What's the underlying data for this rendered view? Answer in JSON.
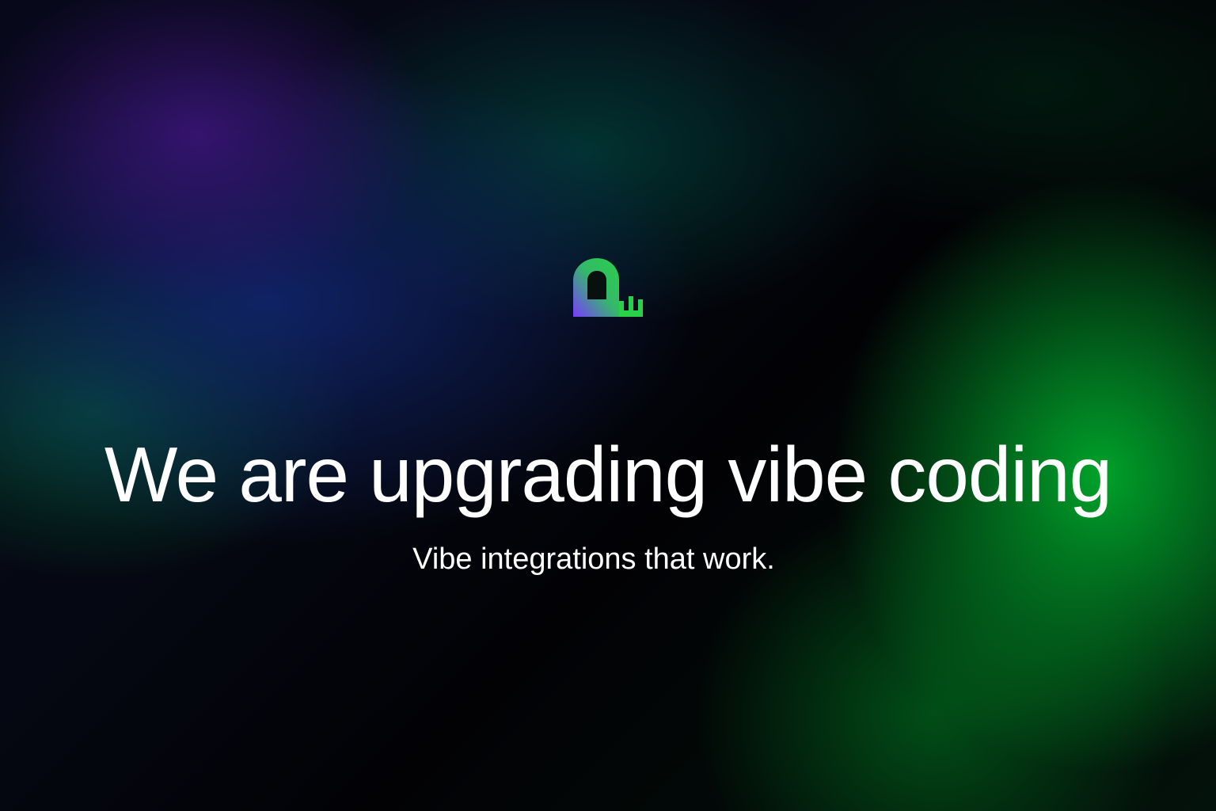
{
  "hero": {
    "logo_icon": "brand-logo-icon",
    "logo_colors": [
      "#7a3cff",
      "#2ad04a"
    ],
    "title": "We are upgrading vibe coding",
    "subtitle": "Vibe integrations that work."
  }
}
